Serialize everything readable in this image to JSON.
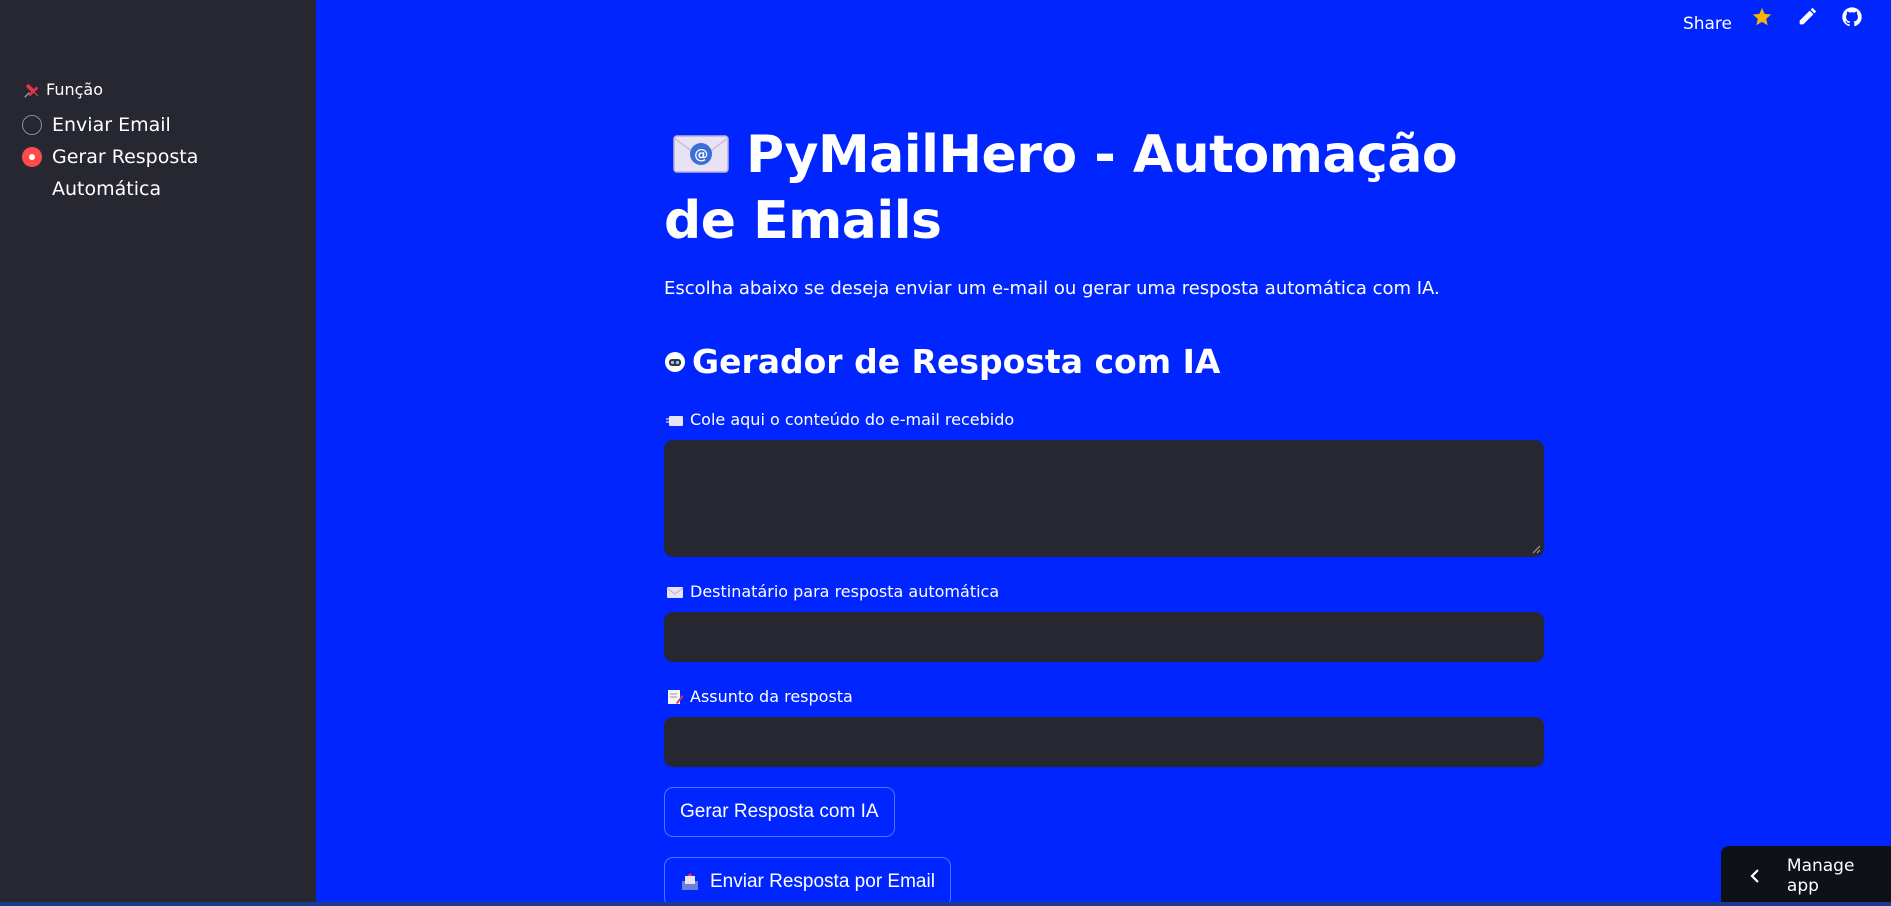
{
  "toolbar": {
    "share_label": "Share",
    "icons": [
      "star-icon",
      "pencil-icon",
      "github-icon"
    ],
    "star_color": "#f5b400"
  },
  "sidebar": {
    "radio_label": "Função",
    "options": [
      {
        "label": "Enviar Email",
        "checked": false
      },
      {
        "label": "Gerar Resposta\nAutomática",
        "checked": true
      }
    ],
    "accent_color": "#ff4b4b"
  },
  "main": {
    "title": "PyMailHero - Automação de Emails",
    "subtitle": "Escolha abaixo se deseja enviar um e-mail ou gerar uma resposta automática com IA.",
    "section_title": "Gerador de Resposta com IA",
    "fields": {
      "email_content_label": "Cole aqui o conteúdo do e-mail recebido",
      "email_content_value": "",
      "recipient_label": "Destinatário para resposta automática",
      "recipient_value": "",
      "subject_label": "Assunto da resposta",
      "subject_value": ""
    },
    "buttons": {
      "generate": "Gerar Resposta com IA",
      "send": "Enviar Resposta por Email"
    }
  },
  "manage_app": {
    "label": "Manage app"
  },
  "colors": {
    "background": "#0025ff",
    "sidebar": "#262730",
    "input_background": "#262730"
  }
}
